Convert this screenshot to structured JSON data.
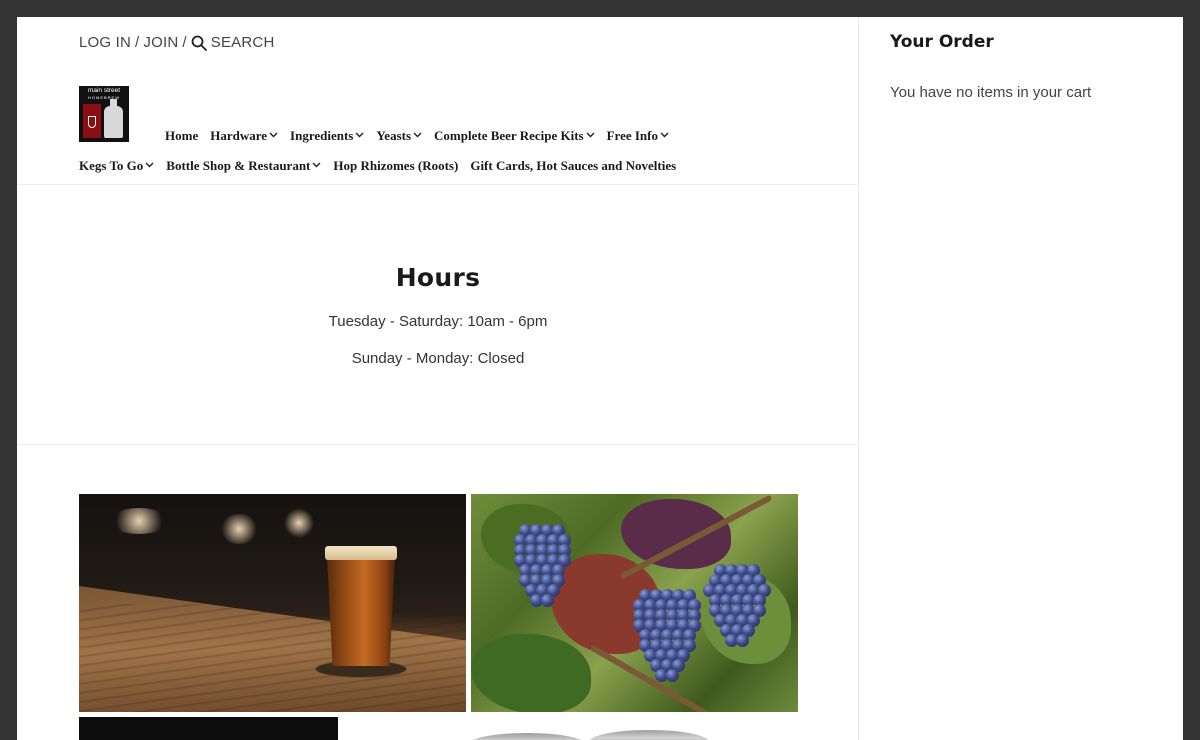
{
  "topbar": {
    "login_label": "LOG IN",
    "join_label": "JOIN",
    "separator": "/",
    "search_label": "SEARCH"
  },
  "logo": {
    "text_line1": "main street",
    "text_line2": "HOMEBREW",
    "alt": "main street homebrew"
  },
  "nav": {
    "row1": [
      {
        "label": "Home",
        "dropdown": false
      },
      {
        "label": "Hardware",
        "dropdown": true
      },
      {
        "label": "Ingredients",
        "dropdown": true
      },
      {
        "label": "Yeasts",
        "dropdown": true
      },
      {
        "label": "Complete Beer Recipe Kits",
        "dropdown": true
      },
      {
        "label": "Free Info",
        "dropdown": true
      }
    ],
    "row2": [
      {
        "label": "Kegs To Go",
        "dropdown": true
      },
      {
        "label": "Bottle Shop & Restaurant",
        "dropdown": true
      },
      {
        "label": "Hop Rhizomes (Roots)",
        "dropdown": false
      },
      {
        "label": "Gift Cards, Hot Sauces and Novelties",
        "dropdown": false
      }
    ]
  },
  "hours": {
    "title": "Hours",
    "line1": "Tuesday - Saturday: 10am - 6pm",
    "line2": "Sunday - Monday: Closed"
  },
  "sidebar": {
    "title": "Your Order",
    "empty_message": "You have no items in your cart"
  },
  "colors": {
    "frame": "#333333",
    "text": "#1a1a1a",
    "divider": "#ececec"
  }
}
